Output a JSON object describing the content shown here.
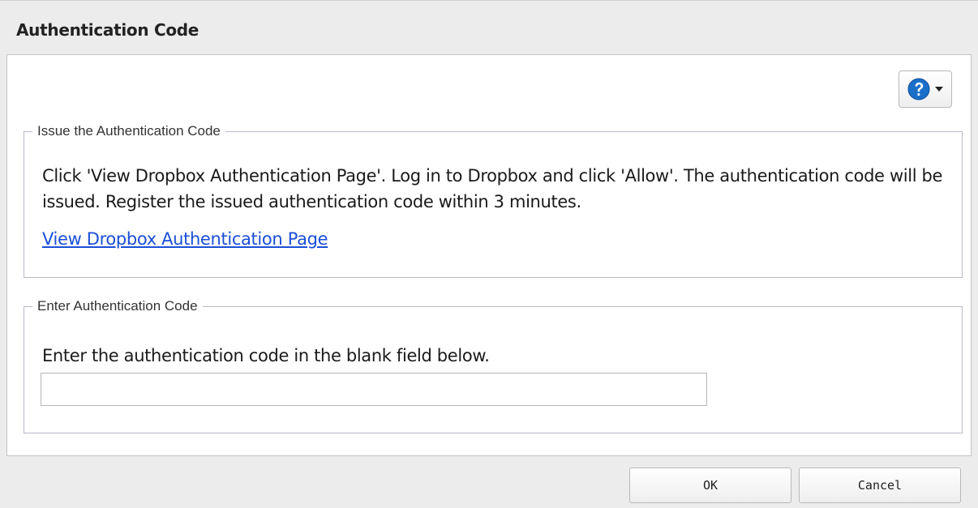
{
  "dialog": {
    "title": "Authentication Code"
  },
  "toolbar": {
    "help_icon": "question-circle-icon",
    "caret_icon": "chevron-down-icon",
    "accent_color": "#1a6fc9"
  },
  "issue_section": {
    "legend": "Issue the Authentication Code",
    "instruction": "Click 'View Dropbox Authentication Page'. Log in to Dropbox and click 'Allow'. The authentication code will be issued. Register the issued authentication code within 3 minutes.",
    "link_text": "View Dropbox Authentication Page",
    "link_color": "#1a4fd6"
  },
  "enter_section": {
    "legend": "Enter Authentication Code",
    "instruction": "Enter the authentication code in the blank field below.",
    "input_value": "",
    "input_placeholder": ""
  },
  "footer": {
    "ok_label": "OK",
    "cancel_label": "Cancel"
  }
}
